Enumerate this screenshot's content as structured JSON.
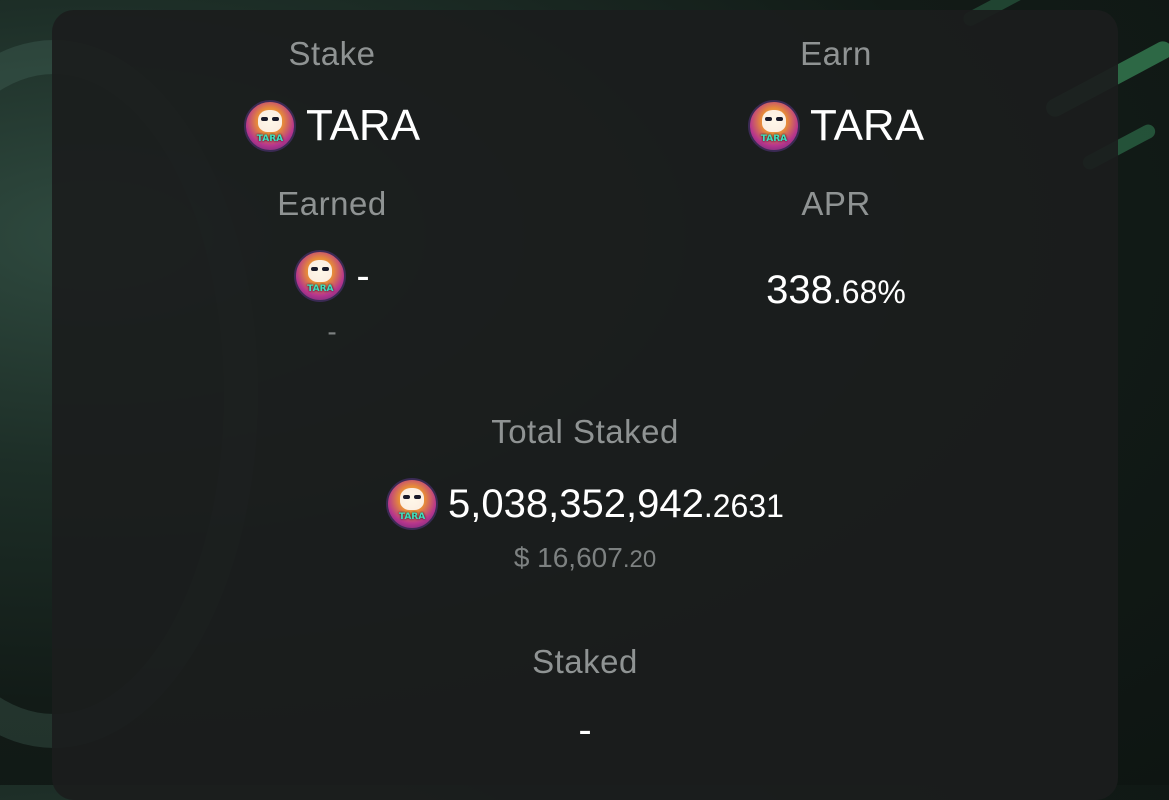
{
  "stake": {
    "label": "Stake",
    "token": "TARA"
  },
  "earn": {
    "label": "Earn",
    "token": "TARA"
  },
  "earned": {
    "label": "Earned",
    "value": "-",
    "usd": "-"
  },
  "apr": {
    "label": "APR",
    "integer": "338",
    "decimal": ".68%"
  },
  "total_staked": {
    "label": "Total Staked",
    "integer": "5,038,352,942",
    "decimal": ".2631",
    "usd_prefix": "$ 16,607",
    "usd_decimal": ".20"
  },
  "staked": {
    "label": "Staked",
    "value": "-"
  },
  "token_icon": {
    "icon": "tara-token-icon",
    "text": "TARA"
  },
  "colors": {
    "card": "#1b1d1d",
    "label": "#8f9393",
    "value": "#ffffff",
    "accent": "#46aa6e"
  }
}
